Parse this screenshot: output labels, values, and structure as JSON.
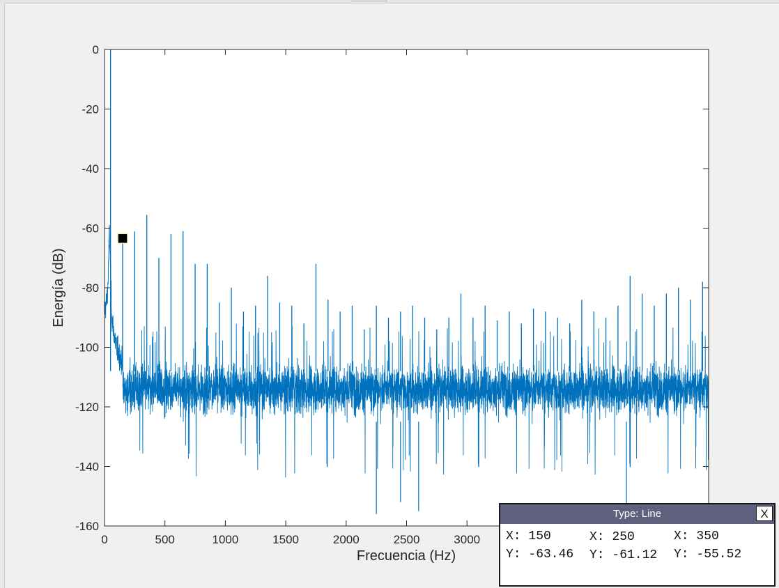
{
  "chart_data": {
    "type": "line",
    "xlabel": "Frecuencia (Hz)",
    "ylabel": "Energía (dB)",
    "xlim": [
      0,
      5000
    ],
    "ylim": [
      -160,
      0
    ],
    "x_ticks": [
      0,
      500,
      1000,
      1500,
      2000,
      2500,
      3000
    ],
    "y_ticks": [
      0,
      -20,
      -40,
      -60,
      -80,
      -100,
      -120,
      -140,
      -160
    ],
    "grid": false,
    "line_color": "#0072bd",
    "noise_floor_mean_db": -114,
    "noise_band_db": [
      -128,
      -100
    ],
    "low_frequency_rolloff": {
      "x": [
        0,
        10,
        20,
        30,
        40,
        60,
        80,
        100,
        150
      ],
      "y": [
        -88,
        -86,
        -84,
        -78,
        -60,
        -90,
        -96,
        -100,
        -106
      ]
    },
    "peaks": {
      "x": [
        50,
        150,
        250,
        350,
        450,
        550,
        650,
        750,
        850,
        950,
        1050,
        1150,
        1250,
        1350,
        1450,
        1550,
        1650,
        1750,
        1850,
        1950,
        2050,
        2150,
        2250,
        2350,
        2450,
        2550,
        2650,
        2750,
        2850,
        2950,
        3050,
        3150,
        3250,
        3350,
        3450,
        3550,
        3650,
        3750,
        3850,
        3950,
        4050,
        4150,
        4250,
        4350,
        4450,
        4550,
        4650,
        4750,
        4850,
        4950
      ],
      "y": [
        0,
        -63.46,
        -61.12,
        -55.52,
        -70,
        -62,
        -61,
        -72,
        -72,
        -85,
        -80,
        -88,
        -86,
        -76,
        -85,
        -86,
        -92,
        -72,
        -84,
        -88,
        -86,
        -94,
        -86,
        -90,
        -88,
        -86,
        -90,
        -94,
        -90,
        -82,
        -90,
        -86,
        -91,
        -88,
        -92,
        -87,
        -88,
        -90,
        -92,
        -84,
        -88,
        -90,
        -86,
        -76,
        -82,
        -86,
        -82,
        -80,
        -84,
        -78
      ]
    },
    "dips": {
      "x": [
        2250,
        2450,
        2600,
        4320
      ],
      "y": [
        -156,
        -152,
        -155,
        -153
      ]
    },
    "marker": {
      "x": 150,
      "y": -63.46,
      "color": "#000000",
      "edge": "#f5f0b5"
    }
  },
  "datatip": {
    "title": "Type:  Line",
    "close_label": "X",
    "points": [
      {
        "x": "X: 150",
        "y": "Y: -63.46"
      },
      {
        "x": "X: 250",
        "y": "Y: -61.12"
      },
      {
        "x": "X: 350",
        "y": "Y: -55.52"
      }
    ]
  },
  "colors": {
    "background": "#f0f0f0",
    "axes_background": "#ffffff",
    "datatip_header": "#5f607d"
  }
}
